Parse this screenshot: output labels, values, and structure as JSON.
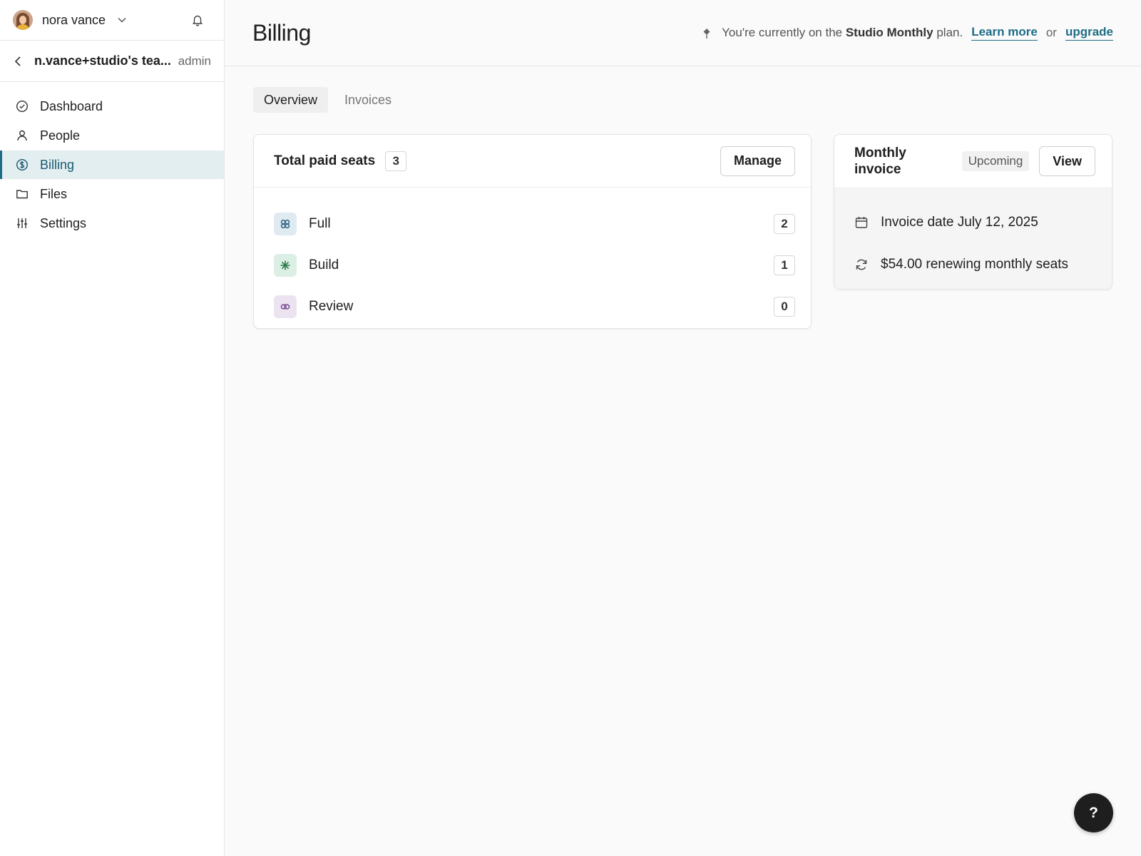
{
  "user": {
    "name": "nora vance"
  },
  "team": {
    "name": "n.vance+studio's tea...",
    "role": "admin"
  },
  "nav": {
    "items": [
      {
        "label": "Dashboard"
      },
      {
        "label": "People"
      },
      {
        "label": "Billing"
      },
      {
        "label": "Files"
      },
      {
        "label": "Settings"
      }
    ],
    "active": "Billing"
  },
  "header": {
    "title": "Billing",
    "plan_prefix": "You're currently on the",
    "plan_name": "Studio Monthly",
    "plan_suffix": "plan.",
    "learn_more": "Learn more",
    "or": "or",
    "upgrade": "upgrade"
  },
  "tabs": [
    {
      "label": "Overview"
    },
    {
      "label": "Invoices"
    }
  ],
  "active_tab": "Overview",
  "seats": {
    "title": "Total paid seats",
    "total": "3",
    "manage_label": "Manage",
    "rows": [
      {
        "label": "Full",
        "count": "2"
      },
      {
        "label": "Build",
        "count": "1"
      },
      {
        "label": "Review",
        "count": "0"
      }
    ]
  },
  "invoice": {
    "title": "Monthly invoice",
    "status": "Upcoming",
    "view_label": "View",
    "date_text": "Invoice date July 12, 2025",
    "renew_text": "$54.00 renewing monthly seats"
  },
  "help": {
    "label": "?"
  },
  "colors": {
    "accent": "#1f6c86",
    "active_nav_bg": "#e3eef1",
    "full_icon_bg": "#dfeaf1",
    "build_icon_bg": "#dcefe4",
    "review_icon_bg": "#ece3f1"
  }
}
